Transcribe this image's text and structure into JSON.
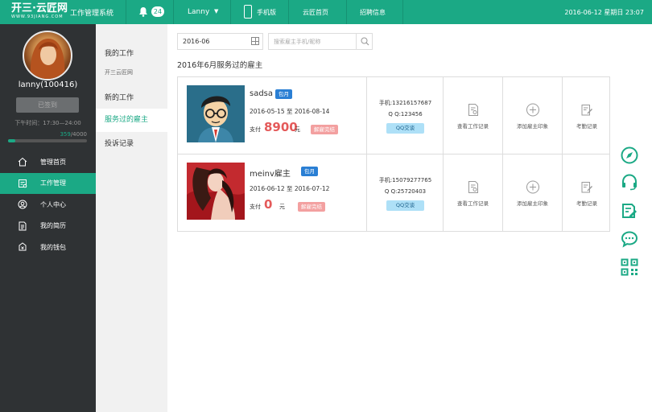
{
  "header": {
    "logo_text": "开三·云匠网",
    "logo_sub": "WWW.93JIANG.COM",
    "system_title": "工作管理系统",
    "notification_count": "24",
    "user_name": "Lanny",
    "nav": [
      "手机版",
      "云匠首页",
      "招聘信息"
    ],
    "datetime": "2016-06-12 星期日 23:07",
    "brand_color": "#1ba985"
  },
  "sidebar": {
    "username": "lanny(100416)",
    "signin_label": "已签到",
    "off_time": "下午时间：17:30—24:00",
    "progress_current": "359",
    "progress_total": "/4000",
    "progress_fraction": 0.09,
    "items": [
      {
        "label": "管理首页",
        "icon": "home-icon"
      },
      {
        "label": "工作管理",
        "icon": "work-icon"
      },
      {
        "label": "个人中心",
        "icon": "user-icon"
      },
      {
        "label": "我的简历",
        "icon": "resume-icon"
      },
      {
        "label": "我的钱包",
        "icon": "wallet-icon"
      }
    ]
  },
  "subnav": {
    "items": [
      "我的工作",
      "开三云匠网",
      "新的工作",
      "服务过的雇主",
      "投诉记录"
    ]
  },
  "main": {
    "date_value": "2016-06",
    "search_placeholder": "搜索雇主手机/昵称",
    "section_title": "2016年6月服务过的雇主",
    "rows": [
      {
        "name": "sadsa",
        "tag": "包月",
        "date_range": "2016-05-15 至 2016-08-14",
        "pay_label": "支付",
        "amount": "8900",
        "unit": "元",
        "release": "解雇完结",
        "phone": "手机:13216157687",
        "qq": "Q Q:123456",
        "qq_btn": "QQ交谈",
        "actions": [
          "查看工作记录",
          "添加雇主印象",
          "考勤记录"
        ]
      },
      {
        "name": "meinv雇主",
        "tag": "包月",
        "date_range": "2016-06-12 至 2016-07-12",
        "pay_label": "支付",
        "amount": "0",
        "unit": "元",
        "release": "解雇完结",
        "phone": "手机:15079277765",
        "qq": "Q Q:25720403",
        "qq_btn": "QQ交谈",
        "actions": [
          "查看工作记录",
          "添加雇主印象",
          "考勤记录"
        ]
      }
    ]
  },
  "float_bar": [
    "compass-icon",
    "headset-icon",
    "edit-note-icon",
    "chat-icon",
    "qrcode-icon"
  ]
}
